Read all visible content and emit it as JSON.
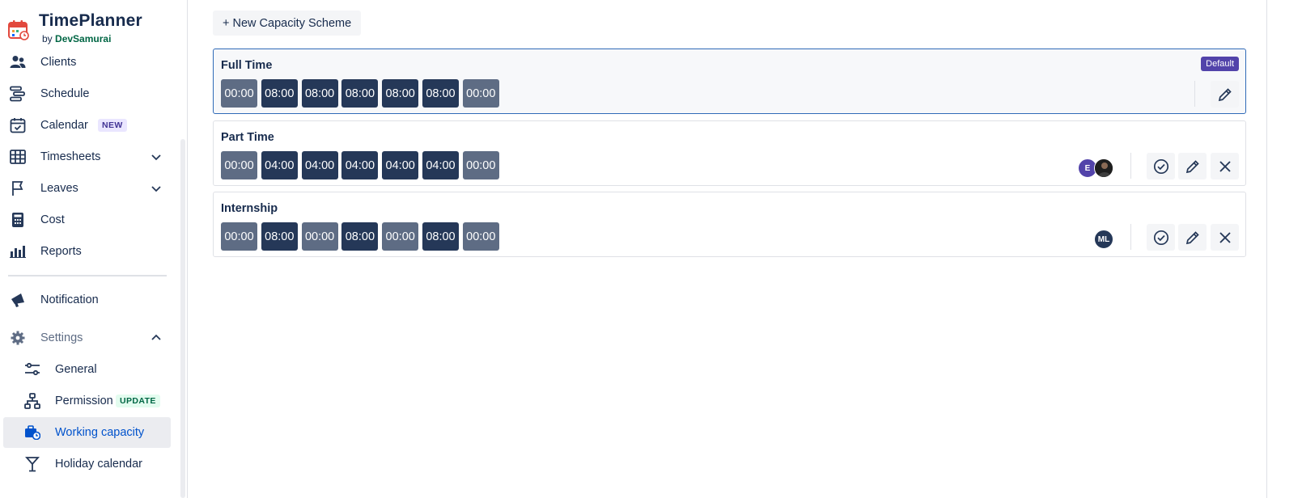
{
  "app": {
    "title": "TimePlanner",
    "by": "by",
    "org": "DevSamurai"
  },
  "nav": {
    "clients": "Clients",
    "schedule": "Schedule",
    "calendar": "Calendar",
    "calendar_tag": "NEW",
    "timesheets": "Timesheets",
    "leaves": "Leaves",
    "cost": "Cost",
    "reports": "Reports",
    "notification": "Notification",
    "settings": "Settings",
    "general": "General",
    "permission": "Permission",
    "permission_tag": "UPDATE",
    "working_capacity": "Working capacity",
    "holiday_calendar": "Holiday calendar"
  },
  "main": {
    "new_scheme_label": "+ New Capacity Scheme",
    "default_label": "Default",
    "schemes": [
      {
        "name": "Full Time",
        "hours": [
          "00:00",
          "08:00",
          "08:00",
          "08:00",
          "08:00",
          "08:00",
          "00:00"
        ]
      },
      {
        "name": "Part Time",
        "hours": [
          "00:00",
          "04:00",
          "04:00",
          "04:00",
          "04:00",
          "04:00",
          "00:00"
        ],
        "avatars": [
          "E",
          ""
        ]
      },
      {
        "name": "Internship",
        "hours": [
          "00:00",
          "08:00",
          "00:00",
          "08:00",
          "00:00",
          "08:00",
          "00:00"
        ],
        "avatars": [
          "ML"
        ]
      }
    ]
  },
  "colors": {
    "working_day": "#253858",
    "off_day": "#5e6c84",
    "accent": "#0052cc",
    "default_badge": "#5243aa"
  }
}
